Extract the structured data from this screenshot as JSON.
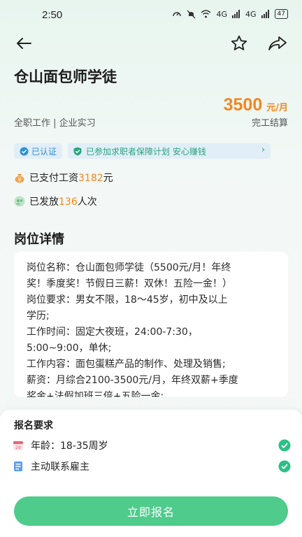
{
  "status_bar": {
    "time": "2:50",
    "network_1": "4G",
    "network_2": "4G",
    "battery": "47"
  },
  "job": {
    "title": "仓山面包师学徒",
    "salary_amount": "3500",
    "salary_unit": "元/月",
    "type": "全职工作 | 企业实习",
    "settlement": "完工结算"
  },
  "badges": {
    "certified": "已认证",
    "guarantee": "已参加求职者保障计划 安心赚钱"
  },
  "stats": {
    "paid_prefix": "已支付工资",
    "paid_amount": "3182",
    "paid_suffix": "元",
    "issued_prefix": "已发放",
    "issued_count": "136",
    "issued_suffix": "人次"
  },
  "details": {
    "section_title": "岗位详情",
    "lines": [
      "岗位名称：仓山面包师学徒（5500元/月！年终",
      "奖！季度奖！节假日三薪！双休！五险一金！）",
      "岗位要求：男女不限，18～45岁，初中及以上",
      "学历;",
      "工作时间：固定大夜班，24:00-7:30，",
      "5:00~9:00，单休;",
      "工作内容：面包蛋糕产品的制作、处理及销售;",
      "薪资：月综合2100-3500元/月，年终双薪+季度",
      "奖金+法假加班三倍+五险一金;"
    ]
  },
  "requirements": {
    "title": "报名要求",
    "items": [
      {
        "label": "年龄：18-35周岁",
        "icon": "calendar-icon"
      },
      {
        "label": "主动联系雇主",
        "icon": "contact-card-icon"
      }
    ]
  },
  "apply_button": "立即报名",
  "colors": {
    "accent_green": "#4fcb8c",
    "salary_orange": "#f4861f",
    "badge_blue": "#2e8fd8",
    "guarantee_green": "#2aa57c"
  }
}
